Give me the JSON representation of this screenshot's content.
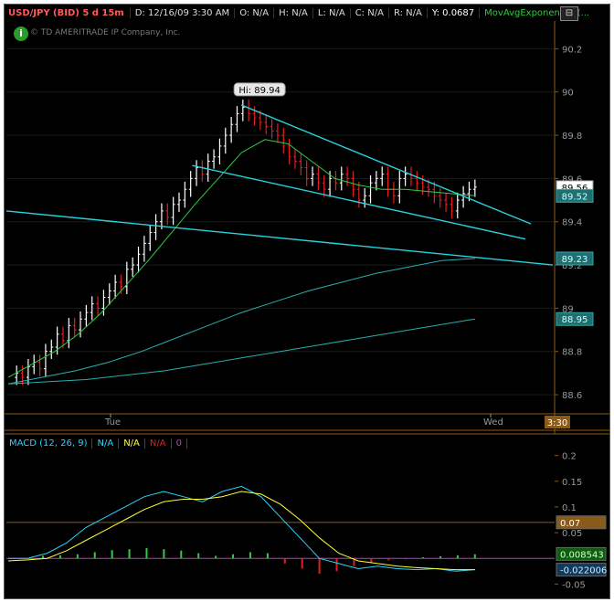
{
  "header": {
    "symbol": "USD/JPY (BID) 5 d 15m",
    "date": "D: 12/16/09 3:30 AM",
    "open": "O: N/A",
    "high": "H: N/A",
    "low": "L: N/A",
    "close": "C: N/A",
    "range": "R: N/A",
    "y": "Y: 0.0687",
    "indicator": "MovAvgExponential (...",
    "window_btn": "⊟"
  },
  "copyright": "© TD AMERITRADE IP Company, Inc.",
  "colors": {
    "up": "#ffffff",
    "down": "#e02020",
    "ema_fast": "#2ecc40",
    "ema_slow": "#25b0b0",
    "trend": "#27d3e0",
    "macd": "#2bd3ff",
    "signal": "#ffff33",
    "hist_up": "#2ecc40",
    "hist_down": "#e02020",
    "zero": "#cc33cc"
  },
  "chart_data": [
    {
      "type": "candlestick",
      "ylim": [
        88.52,
        90.32
      ],
      "y_ticks": [
        "90.2",
        "90",
        "89.8",
        "89.6",
        "89.4",
        "89.2",
        "89",
        "88.8",
        "88.6"
      ],
      "x_labels": [
        "Tue",
        "Wed"
      ],
      "time_badge": "3:30",
      "hi_label": "Hi: 89.94",
      "price_badges": [
        {
          "label": "89.56",
          "value": 89.56,
          "style": "price"
        },
        {
          "label": "89.52",
          "value": 89.52,
          "style": "ema"
        },
        {
          "label": "89.23",
          "value": 89.23,
          "style": "ema"
        },
        {
          "label": "88.95",
          "value": 88.95,
          "style": "ema"
        }
      ],
      "closes": [
        88.7,
        88.68,
        88.73,
        88.75,
        88.72,
        88.8,
        88.82,
        88.88,
        88.85,
        88.92,
        88.9,
        88.95,
        88.98,
        89.02,
        89.0,
        89.05,
        89.08,
        89.12,
        89.1,
        89.18,
        89.2,
        89.25,
        89.3,
        89.35,
        89.4,
        89.45,
        89.42,
        89.48,
        89.5,
        89.55,
        89.6,
        89.65,
        89.62,
        89.68,
        89.7,
        89.75,
        89.8,
        89.85,
        89.9,
        89.93,
        89.9,
        89.88,
        89.86,
        89.84,
        89.82,
        89.8,
        89.75,
        89.7,
        89.68,
        89.65,
        89.6,
        89.62,
        89.58,
        89.55,
        89.6,
        89.58,
        89.62,
        89.6,
        89.55,
        89.5,
        89.52,
        89.58,
        89.6,
        89.62,
        89.55,
        89.52,
        89.6,
        89.62,
        89.6,
        89.58,
        89.56,
        89.55,
        89.52,
        89.5,
        89.48,
        89.45,
        89.5,
        89.53,
        89.55,
        89.56
      ],
      "ema_fast": [
        88.68,
        88.74,
        88.8,
        88.88,
        88.98,
        89.1,
        89.22,
        89.35,
        89.48,
        89.6,
        89.72,
        89.78,
        89.76,
        89.68,
        89.6,
        89.57,
        89.55,
        89.55,
        89.54,
        89.53,
        89.52
      ],
      "ema_slow": [
        88.65,
        88.68,
        88.71,
        88.75,
        88.8,
        88.86,
        88.92,
        88.98,
        89.03,
        89.08,
        89.12,
        89.16,
        89.19,
        89.22,
        89.23
      ],
      "ema_slower": [
        88.65,
        88.66,
        88.67,
        88.69,
        88.71,
        88.74,
        88.77,
        88.8,
        88.83,
        88.86,
        88.89,
        88.92,
        88.95
      ],
      "trendlines": [
        {
          "from": [
            0.43,
            89.94
          ],
          "to": [
            0.96,
            89.39
          ]
        },
        {
          "from": [
            0.34,
            89.66
          ],
          "to": [
            0.95,
            89.32
          ]
        },
        {
          "from": [
            0.0,
            89.45
          ],
          "to": [
            1.0,
            89.2
          ]
        }
      ]
    },
    {
      "type": "macd",
      "title": "MACD (12, 26, 9)",
      "legend": [
        "N/A",
        "N/A",
        "N/A",
        "0"
      ],
      "ylim": [
        -0.06,
        0.21
      ],
      "y_ticks": [
        "0.2",
        "0.15",
        "0.1",
        "0.05",
        "-0.05"
      ],
      "badges": [
        {
          "label": "0.07",
          "value": 0.07
        },
        {
          "label": "0.008543",
          "value": 0.008543
        },
        {
          "label": "-0.022006",
          "value": -0.022006
        }
      ],
      "macd": [
        0.0,
        0.0,
        0.01,
        0.03,
        0.06,
        0.08,
        0.1,
        0.12,
        0.13,
        0.12,
        0.11,
        0.13,
        0.14,
        0.12,
        0.08,
        0.04,
        0.0,
        -0.01,
        -0.02,
        -0.015,
        -0.02,
        -0.022,
        -0.02,
        -0.025,
        -0.022
      ],
      "signal": [
        -0.005,
        -0.003,
        0.0,
        0.015,
        0.035,
        0.055,
        0.075,
        0.095,
        0.11,
        0.115,
        0.115,
        0.12,
        0.13,
        0.125,
        0.105,
        0.075,
        0.04,
        0.01,
        -0.005,
        -0.01,
        -0.015,
        -0.018,
        -0.02,
        -0.022,
        -0.022
      ],
      "hist": [
        0.005,
        0.006,
        0.008,
        0.012,
        0.016,
        0.018,
        0.02,
        0.018,
        0.015,
        0.01,
        0.005,
        0.008,
        0.012,
        0.01,
        -0.01,
        -0.02,
        -0.03,
        -0.025,
        -0.015,
        -0.008,
        -0.004,
        -0.002,
        0.002,
        0.004,
        0.006,
        0.008
      ]
    }
  ]
}
